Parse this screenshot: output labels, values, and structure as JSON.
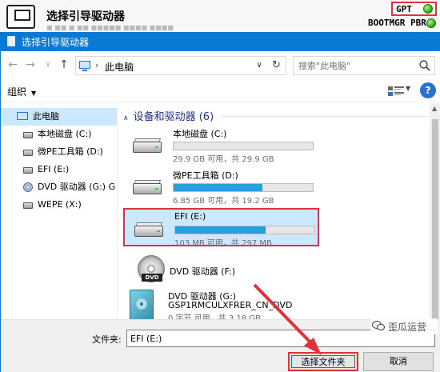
{
  "background_window": {
    "title": "选择引导驱动器",
    "faded_text": "■ ■■ ■  ■■  ■■■■■ ■■■■ ■■■■",
    "gpt_label": "GPT",
    "bootmgr_label": "BOOTMGR PBR",
    "status_color": "#2fa012"
  },
  "dialog": {
    "title": "选择引导驱动器"
  },
  "nav": {
    "back": "←",
    "forward": "→",
    "dropdown": "∨",
    "up": "↑",
    "breadcrumb": "此电脑",
    "refresh": "↻",
    "search_placeholder": "搜索\"此电脑\""
  },
  "toolbar": {
    "organize_label": "组织",
    "help": "?"
  },
  "sidebar": {
    "items": [
      {
        "label": "此电脑",
        "icon": "computer-icon"
      },
      {
        "label": "本地磁盘 (C:)",
        "icon": "drive-icon"
      },
      {
        "label": "微PE工具箱 (D:)",
        "icon": "drive-icon"
      },
      {
        "label": "EFI (E:)",
        "icon": "drive-icon"
      },
      {
        "label": "DVD 驱动器 (G:) G",
        "icon": "dvd-icon"
      },
      {
        "label": "WEPE (X:)",
        "icon": "drive-icon"
      }
    ]
  },
  "main": {
    "group_header": "设备和驱动器 (6)",
    "drives": [
      {
        "name": "本地磁盘 (C:)",
        "info": "29.9 GB 可用，共 29.9 GB",
        "used_fraction": 0.0
      },
      {
        "name": "微PE工具箱 (D:)",
        "info": "6.85 GB 可用，共 19.2 GB",
        "used_fraction": 0.64
      },
      {
        "name": "EFI (E:)",
        "info": "103 MB 可用，共 297 MB",
        "used_fraction": 0.65
      }
    ],
    "dvd_f": {
      "name": "DVD 驱动器 (F:)",
      "badge": "DVD"
    },
    "dvd_g": {
      "line1": "DVD 驱动器 (G:)",
      "line2": "GSP1RMCULXFRER_CN_DVD",
      "line3": "0 字节 可用，共 3.18 GB"
    }
  },
  "bottom": {
    "folder_label": "文件夹:",
    "folder_value": "EFI (E:)",
    "select_button": "选择文件夹",
    "cancel_button": "取消"
  },
  "watermark": {
    "text": "歪瓜运营"
  },
  "colors": {
    "accent": "#0a79d2",
    "highlight": "#e0323a",
    "bar_fill": "#26a0da",
    "selection": "#cce8ff"
  }
}
